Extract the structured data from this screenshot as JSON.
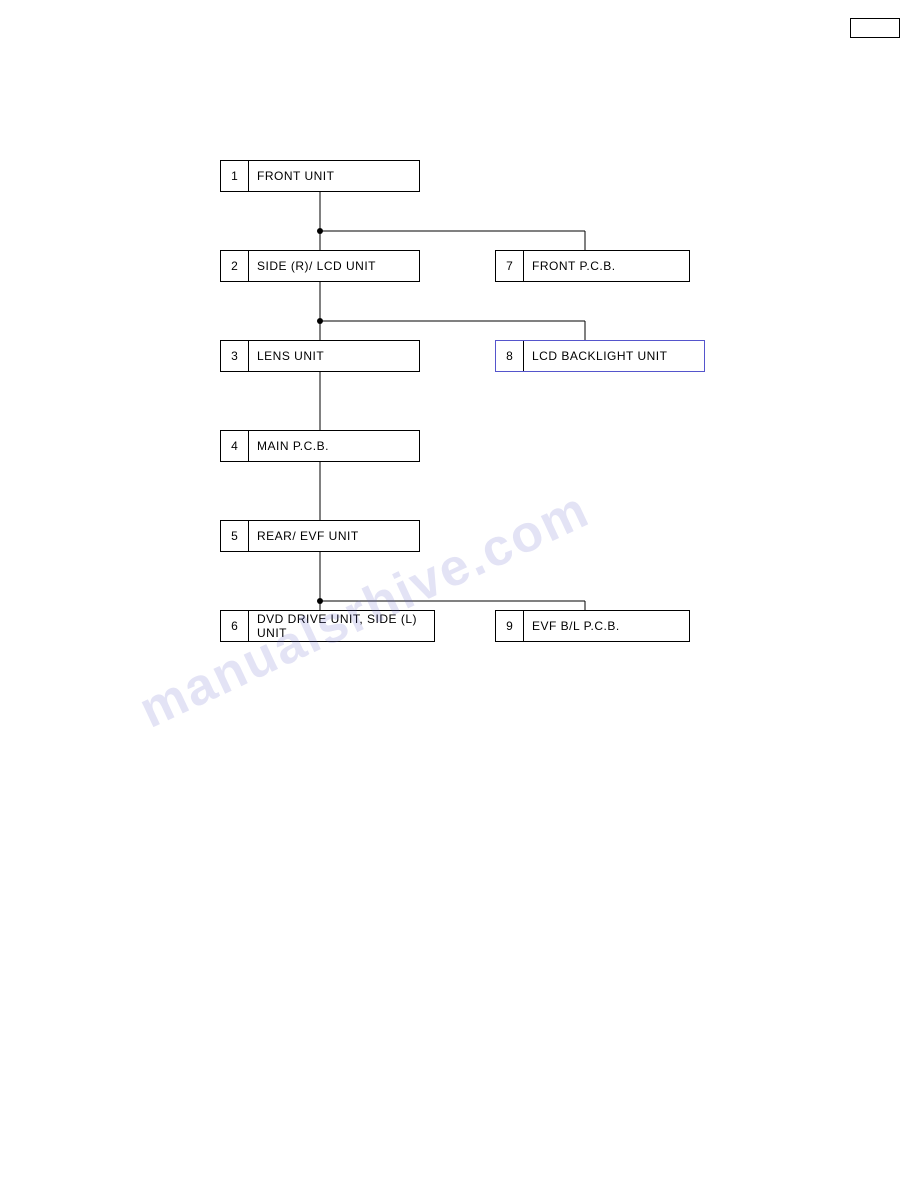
{
  "page": {
    "background": "#ffffff",
    "page_number_box": ""
  },
  "flowchart": {
    "boxes": [
      {
        "id": "box-1",
        "num": "1",
        "label": "FRONT UNIT"
      },
      {
        "id": "box-2",
        "num": "2",
        "label": "SIDE (R)/ LCD UNIT"
      },
      {
        "id": "box-3",
        "num": "3",
        "label": "LENS UNIT"
      },
      {
        "id": "box-4",
        "num": "4",
        "label": "MAIN P.C.B."
      },
      {
        "id": "box-5",
        "num": "5",
        "label": "REAR/ EVF UNIT"
      },
      {
        "id": "box-6",
        "num": "6",
        "label": "DVD DRIVE UNIT, SIDE (L) UNIT"
      },
      {
        "id": "box-7",
        "num": "7",
        "label": "FRONT P.C.B."
      },
      {
        "id": "box-8",
        "num": "8",
        "label": "LCD BACKLIGHT UNIT"
      },
      {
        "id": "box-9",
        "num": "9",
        "label": "EVF B/L P.C.B."
      }
    ],
    "watermark": "manualsrhive.com"
  }
}
